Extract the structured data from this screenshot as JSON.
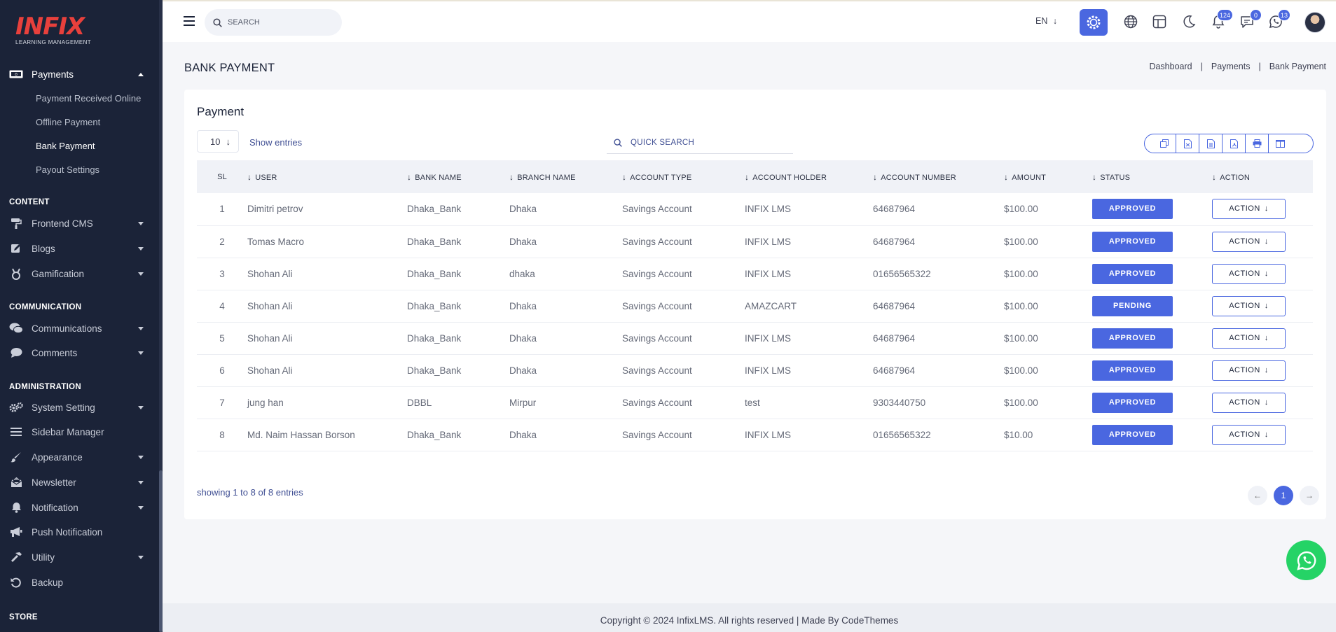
{
  "app": {
    "logo_text": "INFIX",
    "logo_subtitle": "LEARNING MANAGEMENT"
  },
  "sidebar": {
    "payments": {
      "label": "Payments",
      "children": [
        "Payment Received Online",
        "Offline Payment",
        "Bank Payment",
        "Payout Settings"
      ],
      "active_child": "Bank Payment"
    },
    "sections": {
      "content": "CONTENT",
      "communication": "COMMUNICATION",
      "administration": "ADMINISTRATION",
      "store": "STORE"
    },
    "items": {
      "frontend_cms": "Frontend CMS",
      "blogs": "Blogs",
      "gamification": "Gamification",
      "communications": "Communications",
      "comments": "Comments",
      "system_setting": "System Setting",
      "sidebar_manager": "Sidebar Manager",
      "appearance": "Appearance",
      "newsletter": "Newsletter",
      "notification": "Notification",
      "push_notification": "Push Notification",
      "utility": "Utility",
      "backup": "Backup"
    }
  },
  "topbar": {
    "search_placeholder": "SEARCH",
    "language": "EN",
    "notification_count": "124",
    "message_count": "0",
    "chat_count": "13"
  },
  "page": {
    "title": "BANK PAYMENT",
    "breadcrumb": [
      "Dashboard",
      "Payments",
      "Bank Payment"
    ]
  },
  "card": {
    "title": "Payment",
    "entries_value": "10",
    "show_entries_label": "Show entries",
    "quick_search_placeholder": "QUICK SEARCH",
    "columns": [
      "SL",
      "USER",
      "BANK NAME",
      "BRANCH NAME",
      "ACCOUNT TYPE",
      "ACCOUNT HOLDER",
      "ACCOUNT NUMBER",
      "AMOUNT",
      "STATUS",
      "ACTION"
    ],
    "rows": [
      {
        "sl": "1",
        "user": "Dimitri petrov",
        "bank": "Dhaka_Bank",
        "branch": "Dhaka",
        "type": "Savings Account",
        "holder": "INFIX LMS",
        "number": "64687964",
        "amount": "$100.00",
        "status": "APPROVED",
        "action": "ACTION"
      },
      {
        "sl": "2",
        "user": "Tomas Macro",
        "bank": "Dhaka_Bank",
        "branch": "Dhaka",
        "type": "Savings Account",
        "holder": "INFIX LMS",
        "number": "64687964",
        "amount": "$100.00",
        "status": "APPROVED",
        "action": "ACTION"
      },
      {
        "sl": "3",
        "user": "Shohan Ali",
        "bank": "Dhaka_Bank",
        "branch": "dhaka",
        "type": "Savings Account",
        "holder": "INFIX LMS",
        "number": "01656565322",
        "amount": "$100.00",
        "status": "APPROVED",
        "action": "ACTION"
      },
      {
        "sl": "4",
        "user": "Shohan Ali",
        "bank": "Dhaka_Bank",
        "branch": "Dhaka",
        "type": "Savings Account",
        "holder": "AMAZCART",
        "number": "64687964",
        "amount": "$100.00",
        "status": "PENDING",
        "action": "ACTION"
      },
      {
        "sl": "5",
        "user": "Shohan Ali",
        "bank": "Dhaka_Bank",
        "branch": "Dhaka",
        "type": "Savings Account",
        "holder": "INFIX LMS",
        "number": "64687964",
        "amount": "$100.00",
        "status": "APPROVED",
        "action": "ACTION"
      },
      {
        "sl": "6",
        "user": "Shohan Ali",
        "bank": "Dhaka_Bank",
        "branch": "Dhaka",
        "type": "Savings Account",
        "holder": "INFIX LMS",
        "number": "64687964",
        "amount": "$100.00",
        "status": "APPROVED",
        "action": "ACTION"
      },
      {
        "sl": "7",
        "user": "jung han",
        "bank": "DBBL",
        "branch": "Mirpur",
        "type": "Savings Account",
        "holder": "test",
        "number": "9303440750",
        "amount": "$100.00",
        "status": "APPROVED",
        "action": "ACTION"
      },
      {
        "sl": "8",
        "user": "Md. Naim Hassan Borson",
        "bank": "Dhaka_Bank",
        "branch": "Dhaka",
        "type": "Savings Account",
        "holder": "INFIX LMS",
        "number": "01656565322",
        "amount": "$10.00",
        "status": "APPROVED",
        "action": "ACTION"
      }
    ],
    "showing_text": "showing 1 to 8 of 8 entries",
    "current_page": "1"
  },
  "footer": {
    "text": "Copyright © 2024 InfixLMS. All rights reserved | Made By CodeThemes"
  },
  "colors": {
    "primary": "#4a67e0",
    "sidebar_bg": "#1b2338",
    "whatsapp": "#25d366"
  }
}
